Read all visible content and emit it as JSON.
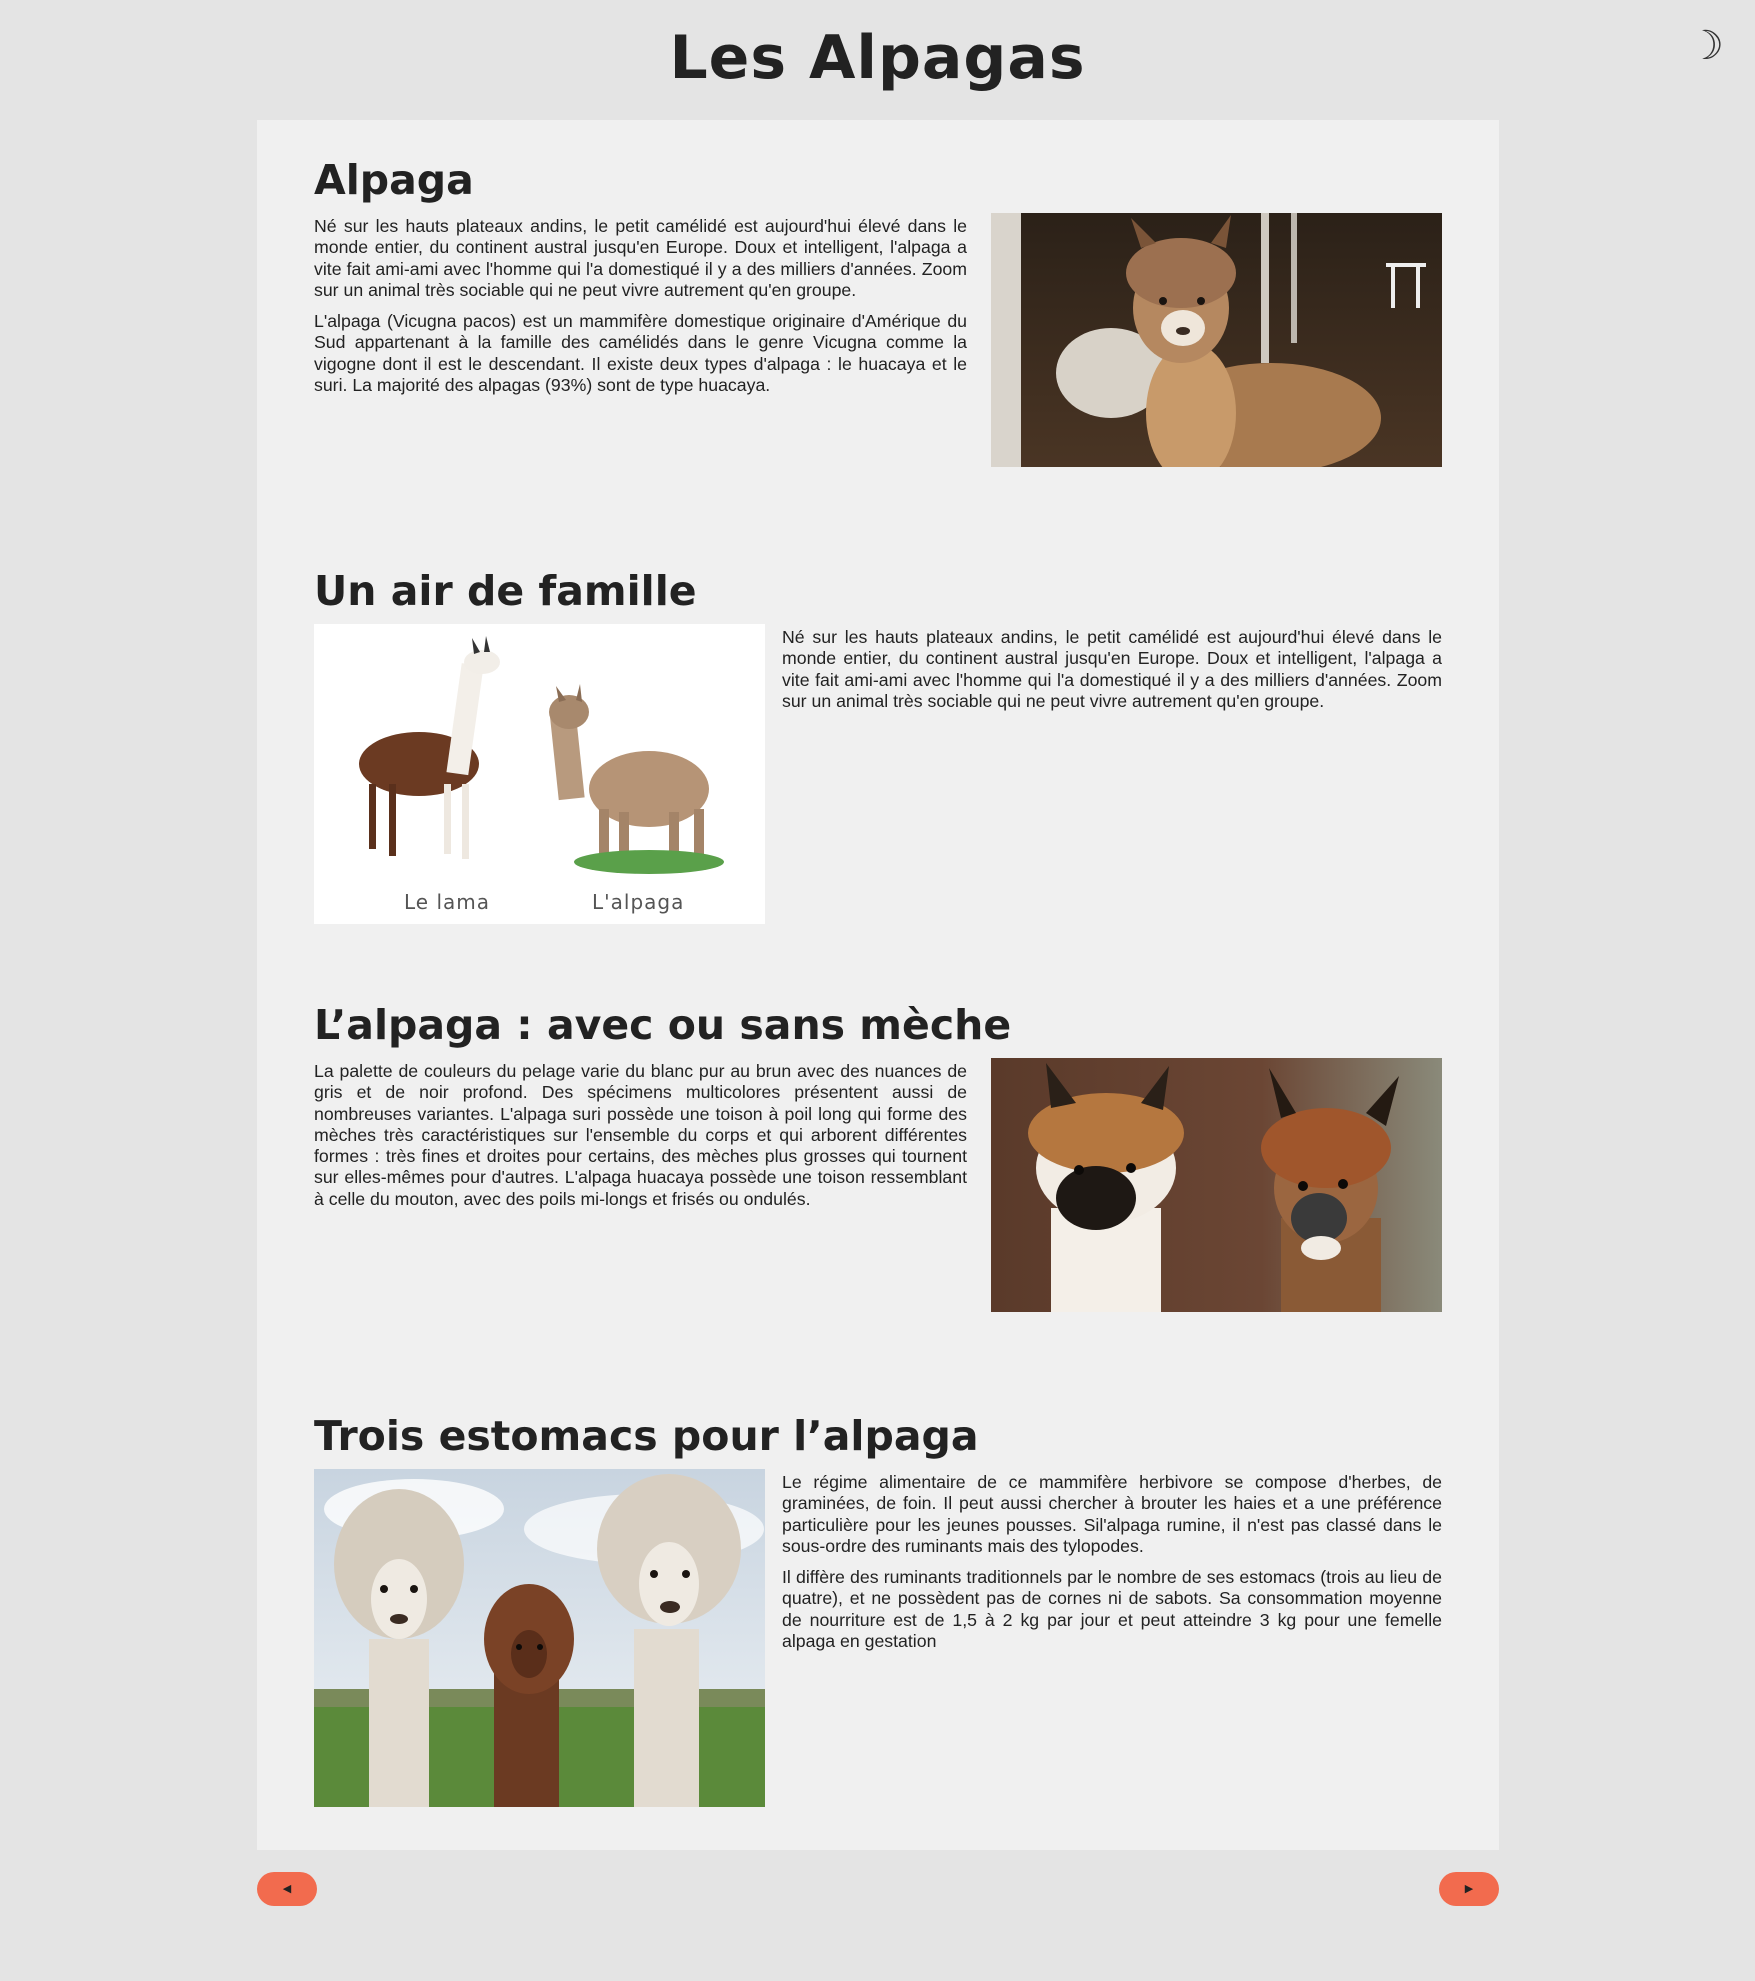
{
  "header": {
    "title": "Les Alpagas",
    "theme_toggle_icon": "☽"
  },
  "sections": [
    {
      "title": "Alpaga",
      "paragraphs": [
        "Né sur les hauts plateaux andins, le petit camélidé est aujourd'hui élevé dans le monde entier, du continent austral jusqu'en Europe. Doux et intelligent, l'alpaga a vite fait ami-ami avec l'homme qui l'a domestiqué il y a des milliers d'années. Zoom sur un animal très sociable qui ne peut vivre autrement qu'en groupe.",
        "L'alpaga (Vicugna pacos) est un mammifère domestique originaire d'Amérique du Sud appartenant à la famille des camélidés dans le genre Vicugna comme la vigogne dont il est le descendant. Il existe deux types d'alpaga : le huacaya et le suri. La majorité des alpagas (93%) sont de type huacaya."
      ],
      "image": "alpaca-portrait-photo"
    },
    {
      "title": "Un air de famille",
      "paragraphs": [
        "Né sur les hauts plateaux andins, le petit camélidé est aujourd'hui élevé dans le monde entier, du continent austral jusqu'en Europe. Doux et intelligent, l'alpaga a vite fait ami-ami avec l'homme qui l'a domestiqué il y a des milliers d'années. Zoom sur un animal très sociable qui ne peut vivre autrement qu'en groupe."
      ],
      "image": "llama-vs-alpaca-photo",
      "image_captions": [
        "Le lama",
        "L'alpaga"
      ]
    },
    {
      "title": "L’alpaga : avec ou sans mèche",
      "paragraphs": [
        "La palette de couleurs du pelage varie du blanc pur au brun avec des nuances de gris et de noir profond. Des spécimens multicolores présentent aussi de nombreuses variantes. L'alpaga suri possède une toison à poil long qui forme des mèches très caractéristiques sur l'ensemble du corps et qui arborent différentes formes : très fines et droites pour certains, des mèches plus grosses qui tournent sur elles-mêmes pour d'autres. L'alpaga huacaya possède une toison ressemblant à celle du mouton, avec des poils mi-longs et frisés ou ondulés."
      ],
      "image": "two-alpaca-heads-photo"
    },
    {
      "title": "Trois estomacs pour l’alpaga",
      "paragraphs": [
        "Le régime alimentaire de ce mammifère herbivore se compose d'herbes, de graminées, de foin. Il peut aussi chercher à brouter les haies et a une préférence particulière pour les jeunes pousses. Sil'alpaga rumine, il n'est pas classé dans le sous-ordre des ruminants mais des tylopodes.",
        "Il diffère des ruminants traditionnels par le nombre de ses estomacs (trois au lieu de quatre), et ne possèdent pas de cornes ni de sabots. Sa consommation moyenne de nourriture est de 1,5 à 2 kg par jour et peut atteindre 3 kg pour une femelle alpaga en gestation"
      ],
      "image": "three-alpacas-photo"
    }
  ],
  "nav": {
    "prev_icon": "◀",
    "next_icon": "▶",
    "button_color": "#f26b4e"
  },
  "colors": {
    "background": "#e4e4e4",
    "card": "#f0f0f0",
    "text": "#222222"
  }
}
